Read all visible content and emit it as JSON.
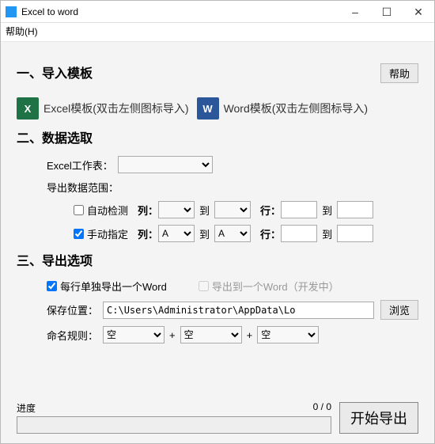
{
  "window": {
    "title": "Excel to word"
  },
  "menu": {
    "help": "帮助(H)"
  },
  "section1": {
    "title": "一、导入模板",
    "help_btn": "帮助",
    "excel_label": "Excel模板(双击左侧图标导入)",
    "word_label": "Word模板(双击左侧图标导入)",
    "excel_glyph": "X",
    "word_glyph": "W"
  },
  "section2": {
    "title": "二、数据选取",
    "worksheet_label": "Excel工作表：",
    "worksheet_value": "",
    "export_range_label": "导出数据范围：",
    "auto_detect": "自动检测",
    "auto_checked": false,
    "manual": "手动指定",
    "manual_checked": true,
    "col_label": "列：",
    "to": "到",
    "row_label": "行：",
    "auto_col_from": "",
    "auto_col_to": "",
    "auto_row_from": "",
    "auto_row_to": "",
    "man_col_from": "A",
    "man_col_to": "A",
    "man_row_from": "",
    "man_row_to": ""
  },
  "section3": {
    "title": "三、导出选项",
    "each_row": "每行单独导出一个Word",
    "each_row_checked": true,
    "single_file": "导出到一个Word（开发中）",
    "single_file_checked": false,
    "save_loc_label": "保存位置：",
    "save_path": "C:\\Users\\Administrator\\AppData\\Lo",
    "browse": "浏览",
    "naming_label": "命名规则：",
    "name1": "空",
    "name2": "空",
    "name3": "空",
    "plus": "+"
  },
  "progress": {
    "label": "进度",
    "text": "0 / 0",
    "start": "开始导出"
  }
}
